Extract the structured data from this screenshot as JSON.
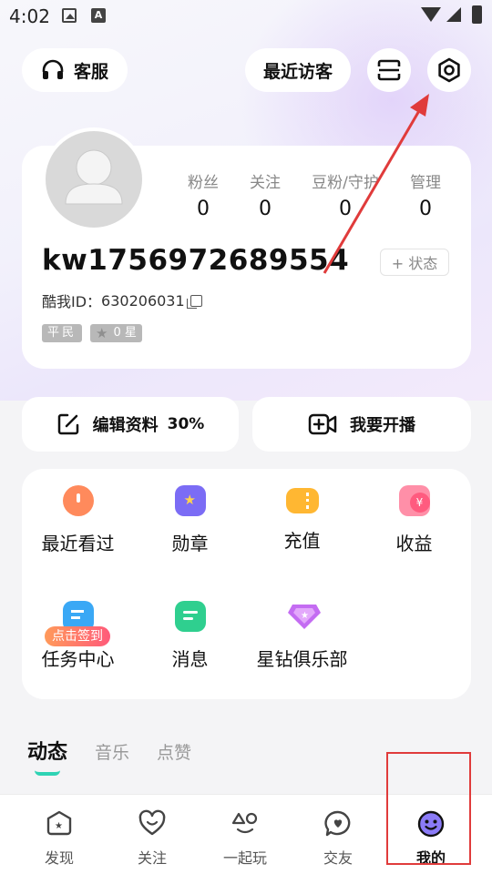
{
  "status_bar": {
    "time": "4:02"
  },
  "header": {
    "service_label": "客服",
    "recent_visitors_label": "最近访客"
  },
  "profile": {
    "username": "kw1756972689554",
    "kuwo_id_label": "酷我ID：",
    "kuwo_id": "630206031",
    "status_button": "+ 状态",
    "level_badge": "平民",
    "star_badge": "0 星",
    "stats": [
      {
        "label": "粉丝",
        "value": "0"
      },
      {
        "label": "关注",
        "value": "0"
      },
      {
        "label": "豆粉/守护",
        "value": "0"
      },
      {
        "label": "管理",
        "value": "0"
      }
    ]
  },
  "actions": {
    "edit_label": "编辑资料",
    "edit_progress": "30%",
    "live_label": "我要开播"
  },
  "grid": {
    "items": [
      {
        "label": "最近看过",
        "icon": "alarm-clock-icon",
        "color": "#ff8a5c"
      },
      {
        "label": "勋章",
        "icon": "medal-icon",
        "color": "#7b6cf5"
      },
      {
        "label": "充值",
        "icon": "ticket-icon",
        "color": "#ffb732"
      },
      {
        "label": "收益",
        "icon": "coin-wallet-icon",
        "color": "#ff5b7f"
      },
      {
        "label": "任务中心",
        "icon": "task-list-icon",
        "color": "#3aa8f5"
      },
      {
        "label": "消息",
        "icon": "chat-bubble-icon",
        "color": "#2fcf8f"
      },
      {
        "label": "星钻俱乐部",
        "icon": "diamond-icon",
        "color": "#c46cf2"
      }
    ],
    "sign_in_tag": "点击签到"
  },
  "feed_tabs": [
    {
      "label": "动态",
      "active": true
    },
    {
      "label": "音乐",
      "active": false
    },
    {
      "label": "点赞",
      "active": false
    }
  ],
  "bottom_nav": [
    {
      "label": "发现",
      "active": false
    },
    {
      "label": "关注",
      "active": false
    },
    {
      "label": "一起玩",
      "active": false
    },
    {
      "label": "交友",
      "active": false
    },
    {
      "label": "我的",
      "active": true
    }
  ],
  "colors": {
    "accent": "#2ed3b4",
    "annotation": "#e03b3b"
  }
}
